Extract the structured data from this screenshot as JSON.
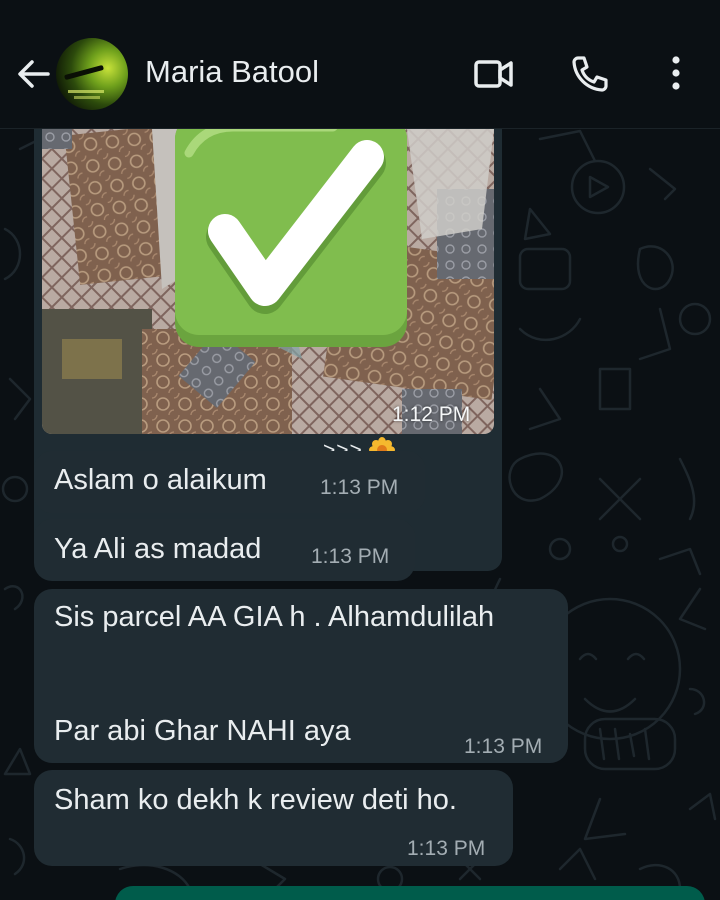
{
  "header": {
    "contact_name": "Maria Batool",
    "icons": {
      "back": "arrow-left-icon",
      "video": "video-camera-icon",
      "call": "phone-icon",
      "menu": "more-vert-icon"
    }
  },
  "messages": [
    {
      "type": "image",
      "time": "1:12 PM",
      "overlay": "check-mark-button-emoji"
    },
    {
      "type": "text",
      "forwarded_tag": ">>>",
      "text": "Aslam o alaikum",
      "time": "1:13 PM"
    },
    {
      "type": "text",
      "text": "Ya Ali as madad",
      "time": "1:13 PM"
    },
    {
      "type": "text",
      "line1": "Sis parcel AA GIA h . Alhamdulilah",
      "line2": "Par abi Ghar NAHI aya",
      "time": "1:13 PM"
    },
    {
      "type": "text",
      "text": "Sham ko dekh k review deti ho.",
      "time": "1:13 PM"
    }
  ],
  "colors": {
    "background": "#0b1014",
    "incoming_bubble": "#202c33",
    "outgoing_bubble": "#005c4b",
    "timestamp": "#a3adb3",
    "check_green": "#77b255"
  }
}
